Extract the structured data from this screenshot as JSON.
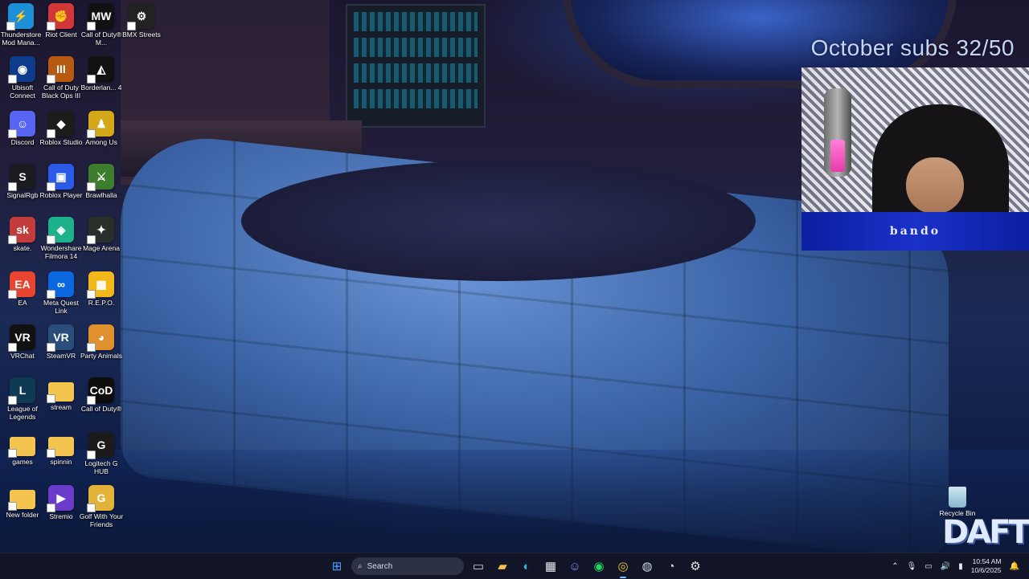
{
  "overlay": {
    "subs_text": "October subs 32/50",
    "webcam_banner": "bando",
    "logo_text": "DAFT"
  },
  "desktop_icons": [
    {
      "label": "Thunderstore Mod Mana...",
      "icon": "thunderstore-icon",
      "color": "#1c8fd6"
    },
    {
      "label": "Riot Client",
      "icon": "riot-client-icon",
      "color": "#d13639"
    },
    {
      "label": "Call of Duty® M...",
      "icon": "call-of-duty-mw-icon",
      "color": "#111111"
    },
    {
      "label": "BMX Streets",
      "icon": "bmx-streets-icon",
      "color": "#222222"
    },
    {
      "label": "Ubisoft Connect",
      "icon": "ubisoft-connect-icon",
      "color": "#0d3c8c"
    },
    {
      "label": "Call of Duty Black Ops III",
      "icon": "black-ops-3-icon",
      "color": "#b75a11"
    },
    {
      "label": "Borderlan... 4",
      "icon": "borderlands-4-icon",
      "color": "#111111"
    },
    {
      "label": "Discord",
      "icon": "discord-icon",
      "color": "#5865f2"
    },
    {
      "label": "Roblox Studio",
      "icon": "roblox-studio-icon",
      "color": "#1c1c1c"
    },
    {
      "label": "Among Us",
      "icon": "among-us-icon",
      "color": "#d3a91a"
    },
    {
      "label": "SignalRgb",
      "icon": "signalrgb-icon",
      "color": "#1b1b22"
    },
    {
      "label": "Roblox Player",
      "icon": "roblox-player-icon",
      "color": "#2b5ae8"
    },
    {
      "label": "Brawlhalla",
      "icon": "brawlhalla-icon",
      "color": "#3d7d2e"
    },
    {
      "label": "skate.",
      "icon": "skate-icon",
      "color": "#c23c3c"
    },
    {
      "label": "Wondershare Filmora 14",
      "icon": "filmora-icon",
      "color": "#1db18c"
    },
    {
      "label": "Mage Arena",
      "icon": "mage-arena-icon",
      "color": "#2a2f2a"
    },
    {
      "label": "EA",
      "icon": "ea-icon",
      "color": "#e8442f"
    },
    {
      "label": "Meta Quest Link",
      "icon": "meta-quest-link-icon",
      "color": "#0b67e0"
    },
    {
      "label": "R.E.P.O.",
      "icon": "repo-icon",
      "color": "#f2b81b"
    },
    {
      "label": "VRChat",
      "icon": "vrchat-icon",
      "color": "#111111"
    },
    {
      "label": "SteamVR",
      "icon": "steamvr-icon",
      "color": "#2a4e7a"
    },
    {
      "label": "Party Animals",
      "icon": "party-animals-icon",
      "color": "#e0902c"
    },
    {
      "label": "League of Legends",
      "icon": "league-of-legends-icon",
      "color": "#0f3a54"
    },
    {
      "label": "stream",
      "icon": "folder-icon",
      "color": "#f4c44f"
    },
    {
      "label": "Call of Duty®",
      "icon": "call-of-duty-icon",
      "color": "#0d0d0d"
    },
    {
      "label": "games",
      "icon": "folder-icon",
      "color": "#f4c44f"
    },
    {
      "label": "spinnin",
      "icon": "folder-icon",
      "color": "#f4c44f"
    },
    {
      "label": "Logitech G HUB",
      "icon": "logitech-ghub-icon",
      "color": "#1b1b1b"
    },
    {
      "label": "New folder",
      "icon": "folder-icon",
      "color": "#f4c44f"
    },
    {
      "label": "Stremio",
      "icon": "stremio-icon",
      "color": "#6b3cc9"
    },
    {
      "label": "Golf With Your Friends",
      "icon": "golf-with-your-friends-icon",
      "color": "#e2b338"
    }
  ],
  "icon_glyphs": {
    "thunderstore-icon": "⚡",
    "riot-client-icon": "✊",
    "call-of-duty-mw-icon": "MW",
    "bmx-streets-icon": "⚙",
    "ubisoft-connect-icon": "◉",
    "black-ops-3-icon": "III",
    "borderlands-4-icon": "◭",
    "discord-icon": "☺",
    "roblox-studio-icon": "◆",
    "among-us-icon": "♟",
    "signalrgb-icon": "S",
    "roblox-player-icon": "▣",
    "brawlhalla-icon": "⚔",
    "skate-icon": "sk",
    "filmora-icon": "◈",
    "mage-arena-icon": "✦",
    "ea-icon": "EA",
    "meta-quest-link-icon": "∞",
    "repo-icon": "▦",
    "vrchat-icon": "VR",
    "steamvr-icon": "VR",
    "party-animals-icon": "◕",
    "league-of-legends-icon": "L",
    "folder-icon": "",
    "call-of-duty-icon": "CoD",
    "logitech-ghub-icon": "G",
    "stremio-icon": "▶",
    "golf-with-your-friends-icon": "G"
  },
  "recycle_bin": {
    "label": "Recycle Bin"
  },
  "taskbar": {
    "search_placeholder": "Search",
    "apps": [
      {
        "name": "start-button",
        "glyph": "⊞",
        "color": "#4aa3ff"
      },
      {
        "name": "search-box",
        "glyph": "",
        "color": "#ffffff"
      },
      {
        "name": "task-view-button",
        "glyph": "▭",
        "color": "#d0d4e0"
      },
      {
        "name": "file-explorer-button",
        "glyph": "▰",
        "color": "#f4c44f"
      },
      {
        "name": "edge-button",
        "glyph": "◐",
        "color": "#2fb6d8"
      },
      {
        "name": "store-button",
        "glyph": "▦",
        "color": "#e8e8f0"
      },
      {
        "name": "discord-taskbar-button",
        "glyph": "☺",
        "color": "#7d86f5"
      },
      {
        "name": "spotify-button",
        "glyph": "◉",
        "color": "#1ed760"
      },
      {
        "name": "chrome-button",
        "glyph": "◎",
        "color": "#f1c233"
      },
      {
        "name": "steam-button",
        "glyph": "◍",
        "color": "#c9d4e6"
      },
      {
        "name": "obs-button",
        "glyph": "◔",
        "color": "#d6d6d6"
      },
      {
        "name": "settings-button",
        "glyph": "⚙",
        "color": "#e6e6e6"
      }
    ],
    "clock_time": "10:54 AM",
    "clock_date": "10/6/2025"
  }
}
